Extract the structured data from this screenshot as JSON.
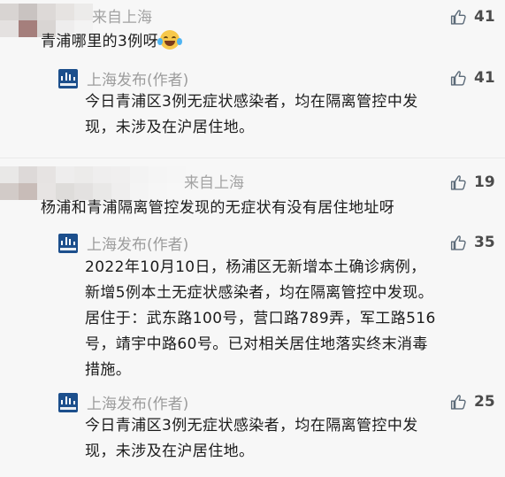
{
  "comments": [
    {
      "region": "来自上海",
      "likes": "41",
      "text": "青浦哪里的3例呀",
      "emoji": "grinning-sweat-emoji",
      "replies": [
        {
          "author": "上海发布(作者)",
          "likes": "41",
          "lines": [
            "今日青浦区3例无症状感染者，均在隔离管控中发",
            "现，未涉及在沪居住地。"
          ]
        }
      ]
    },
    {
      "region": "来自上海",
      "likes": "19",
      "text": "杨浦和青浦隔离管控发现的无症状有没有居住地址呀",
      "replies": [
        {
          "author": "上海发布(作者)",
          "likes": "35",
          "lines": [
            "2022年10月10日，杨浦区无新增本土确诊病例，",
            "新增5例本土无症状感染者，均在隔离管控中发现。",
            "居住于：武东路100号，营口路789弄，军工路516",
            "号，靖宇中路60号。已对相关居住地落实终末消毒",
            "措施。"
          ]
        },
        {
          "author": "上海发布(作者)",
          "likes": "25",
          "lines": [
            "今日青浦区3例无症状感染者，均在隔离管控中发",
            "现，未涉及在沪居住地。"
          ]
        }
      ]
    }
  ],
  "colors": {
    "background": "#f7f7f7",
    "logo": "#1c4f8c",
    "secondary_text": "#9c9c9c"
  },
  "icons": {
    "like": "thumbs-up-icon",
    "author_logo": "shanghai-release-logo"
  }
}
